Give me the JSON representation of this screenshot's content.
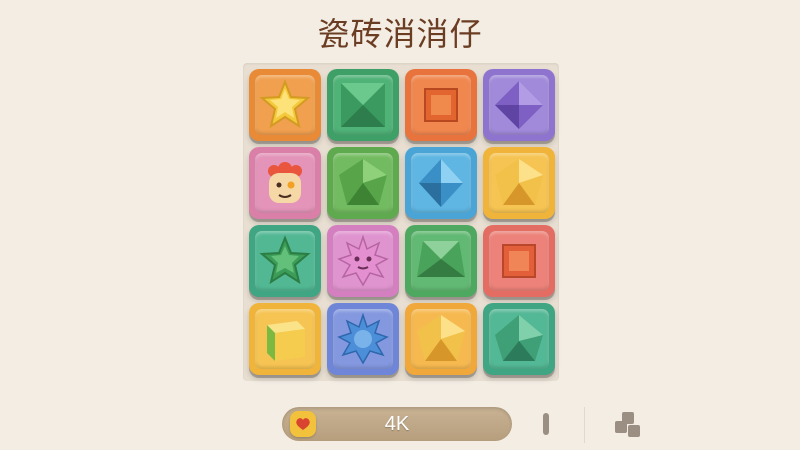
{
  "title": "瓷砖消消仔",
  "score": "4K",
  "colors": {
    "background": "#f3ede4",
    "orange": "#e98a36",
    "green": "#3ea067",
    "purple": "#8e74cf",
    "pink": "#d97fa8",
    "blue": "#4aa5d6",
    "yellow": "#f0b43a",
    "teal": "#3fa582",
    "red": "#e36d63",
    "title": "#6b3d22"
  },
  "grid": [
    [
      {
        "color": "orange",
        "icon": "star-icon"
      },
      {
        "color": "green",
        "icon": "green-square-gem-icon"
      },
      {
        "color": "orange",
        "icon": "orange-square-gem-icon"
      },
      {
        "color": "purple",
        "icon": "purple-diamond-icon"
      }
    ],
    [
      {
        "color": "pink",
        "icon": "sun-face-icon"
      },
      {
        "color": "green",
        "icon": "green-pentagon-icon"
      },
      {
        "color": "blue",
        "icon": "blue-diamond-icon"
      },
      {
        "color": "yellow",
        "icon": "yellow-pentagon-icon"
      }
    ],
    [
      {
        "color": "teal",
        "icon": "green-star-icon"
      },
      {
        "color": "pink",
        "icon": "pink-spiky-icon"
      },
      {
        "color": "green",
        "icon": "green-gem-icon"
      },
      {
        "color": "red",
        "icon": "red-square-gem-icon"
      }
    ],
    [
      {
        "color": "yellow",
        "icon": "cube-icon"
      },
      {
        "color": "blue",
        "icon": "blue-spiky-icon"
      },
      {
        "color": "yellow",
        "icon": "yellow-pentagon-icon"
      },
      {
        "color": "teal",
        "icon": "teal-gem-icon"
      }
    ]
  ],
  "bottom_bar": {
    "badge_icon": "heart-badge-icon",
    "pause_icon": "pause-bar-icon",
    "blocks_icon": "blocks-icon"
  }
}
